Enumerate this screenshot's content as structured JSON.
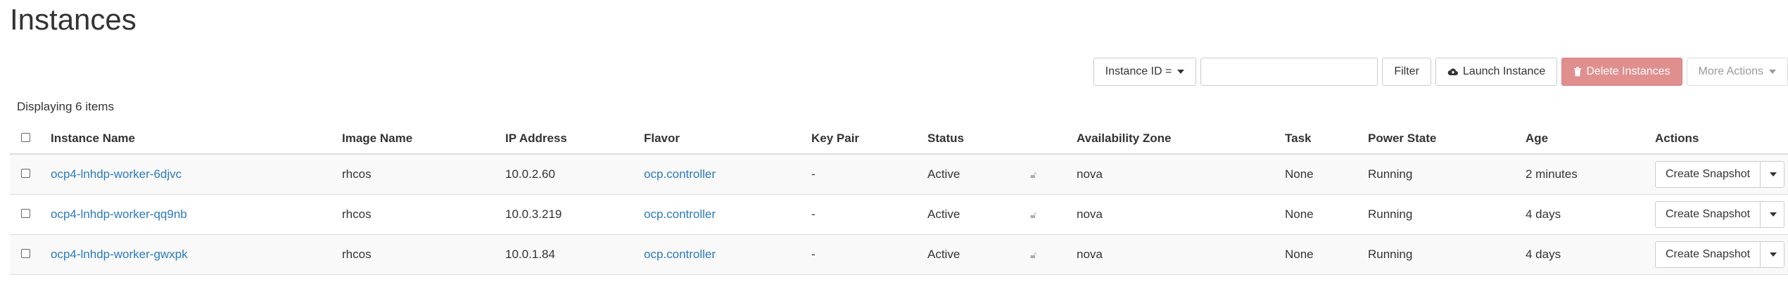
{
  "page": {
    "title": "Instances"
  },
  "toolbar": {
    "filter_field_label": "Instance ID =",
    "filter_input_value": "",
    "filter_button": "Filter",
    "launch_button": "Launch Instance",
    "delete_button": "Delete Instances",
    "more_actions_button": "More Actions"
  },
  "table": {
    "items_count": "Displaying 6 items",
    "columns": [
      "Instance Name",
      "Image Name",
      "IP Address",
      "Flavor",
      "Key Pair",
      "Status",
      "Availability Zone",
      "Task",
      "Power State",
      "Age",
      "Actions"
    ],
    "rows": [
      {
        "name": "ocp4-lnhdp-worker-6djvc",
        "image": "rhcos",
        "ip": "10.0.2.60",
        "flavor": "ocp.controller",
        "key_pair": "-",
        "status": "Active",
        "zone": "nova",
        "task": "None",
        "power": "Running",
        "age": "2 minutes",
        "action": "Create Snapshot"
      },
      {
        "name": "ocp4-lnhdp-worker-qq9nb",
        "image": "rhcos",
        "ip": "10.0.3.219",
        "flavor": "ocp.controller",
        "key_pair": "-",
        "status": "Active",
        "zone": "nova",
        "task": "None",
        "power": "Running",
        "age": "4 days",
        "action": "Create Snapshot"
      },
      {
        "name": "ocp4-lnhdp-worker-gwxpk",
        "image": "rhcos",
        "ip": "10.0.1.84",
        "flavor": "ocp.controller",
        "key_pair": "-",
        "status": "Active",
        "zone": "nova",
        "task": "None",
        "power": "Running",
        "age": "4 days",
        "action": "Create Snapshot"
      }
    ]
  },
  "colors": {
    "link": "#2a7abf",
    "danger": "#e08f8f"
  },
  "icons": {
    "launch": "cloud-upload-icon",
    "delete": "trash-icon",
    "lock": "unlocked-icon"
  }
}
